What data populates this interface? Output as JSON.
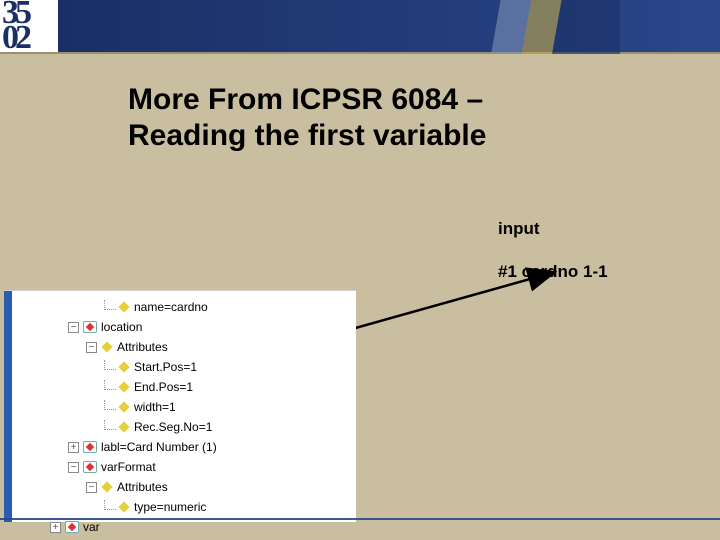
{
  "header": {
    "logo_top": "35",
    "logo_bottom": "02"
  },
  "title": {
    "line1": "More From ICPSR 6084 –",
    "line2": "Reading the first variable"
  },
  "labels": {
    "input": "input",
    "code": "#1 cardno   1-1"
  },
  "tree": {
    "n_name": "name=cardno",
    "n_loc": "location",
    "n_attr1": "Attributes",
    "n_start": "Start.Pos=1",
    "n_end": "End.Pos=1",
    "n_width": "width=1",
    "n_recseg": "Rec.Seg.No=1",
    "n_labl": "labl=Card Number (1)",
    "n_varf": "varFormat",
    "n_attr2": "Attributes",
    "n_type": "type=numeric",
    "n_var": "var"
  },
  "twisty": {
    "plus": "+",
    "minus": "−"
  }
}
